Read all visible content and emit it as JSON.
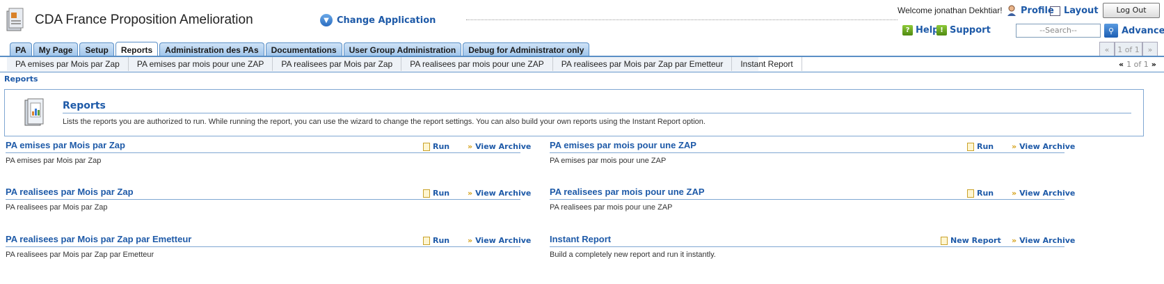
{
  "header": {
    "app_title": "CDA France Proposition Amelioration",
    "change_app": "Change Application",
    "welcome": "Welcome jonathan Dekhtiar!",
    "profile": "Profile",
    "layout": "Layout",
    "logout": "Log Out",
    "help": "Help",
    "support": "Support",
    "search_placeholder": "--Search--",
    "advanced": "Advanced"
  },
  "tabs": [
    {
      "label": "PA"
    },
    {
      "label": "My Page"
    },
    {
      "label": "Setup"
    },
    {
      "label": "Reports",
      "active": true
    },
    {
      "label": "Administration des PAs"
    },
    {
      "label": "Documentations"
    },
    {
      "label": "User Group Administration"
    },
    {
      "label": "Debug for Administrator only"
    }
  ],
  "tab_pager": {
    "prev": "«",
    "page": "1 of 1",
    "next": "»"
  },
  "subtabs": [
    "PA emises par Mois par Zap",
    "PA emises par mois pour une ZAP",
    "PA realisees par Mois par Zap",
    "PA realisees par mois pour une ZAP",
    "PA realisees par Mois par Zap par Emetteur",
    "Instant Report"
  ],
  "subtab_pager": {
    "prev": "«",
    "page": "1 of 1",
    "next": "»"
  },
  "breadcrumb": "Reports",
  "info": {
    "title": "Reports",
    "description": "Lists the reports you are authorized to run. While running the report, you can use the wizard to change the report settings. You can also build your own reports using the Instant Report option."
  },
  "reports": [
    {
      "title": "PA emises par Mois par Zap",
      "desc": "PA emises par Mois par Zap",
      "action": "Run",
      "archive": "View Archive"
    },
    {
      "title": "PA emises par mois pour une ZAP",
      "desc": "PA emises par mois pour une ZAP",
      "action": "Run",
      "archive": "View Archive"
    },
    {
      "title": "PA realisees par Mois par Zap",
      "desc": "PA realisees par Mois par Zap",
      "action": "Run",
      "archive": "View Archive"
    },
    {
      "title": "PA realisees par mois pour une ZAP",
      "desc": "PA realisees par mois pour une ZAP",
      "action": "Run",
      "archive": "View Archive"
    },
    {
      "title": "PA realisees par Mois par Zap par Emetteur",
      "desc": "PA realisees par Mois par Zap par Emetteur",
      "action": "Run",
      "archive": "View Archive"
    },
    {
      "title": "Instant Report",
      "desc": "Build a completely new report and run it instantly.",
      "action": "New Report",
      "archive": "View Archive"
    }
  ]
}
